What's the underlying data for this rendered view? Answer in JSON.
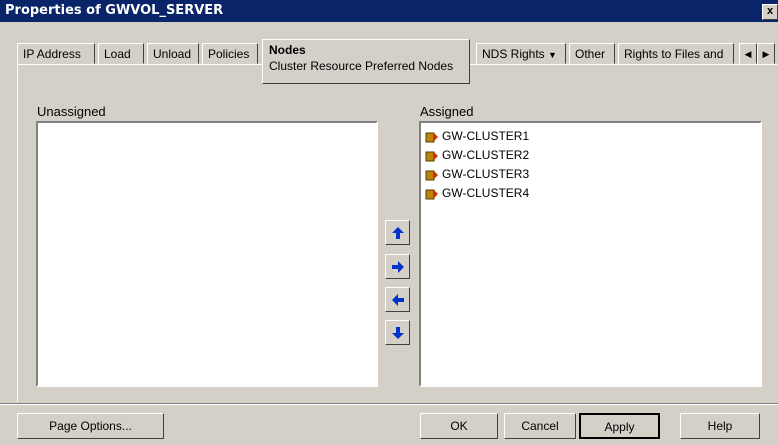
{
  "window": {
    "title": "Properties of GWVOL_SERVER",
    "close_glyph": "x"
  },
  "tabs": {
    "ip_address": "IP Address",
    "load": "Load",
    "unload": "Unload",
    "policies": "Policies",
    "nodes": "Nodes",
    "nodes_sub": "Cluster Resource Preferred Nodes",
    "nds_rights": "NDS Rights",
    "other": "Other",
    "rights_files": "Rights to Files and"
  },
  "lists": {
    "unassigned_label": "Unassigned",
    "assigned_label": "Assigned",
    "unassigned_items": [],
    "assigned_items": [
      "GW-CLUSTER1",
      "GW-CLUSTER2",
      "GW-CLUSTER3",
      "GW-CLUSTER4"
    ]
  },
  "buttons": {
    "page_options": "Page Options...",
    "ok": "OK",
    "cancel": "Cancel",
    "apply": "Apply",
    "help": "Help"
  },
  "colors": {
    "titlebar": "#0a246a",
    "dialog": "#d4d0c8",
    "arrow": "#0033cc"
  }
}
